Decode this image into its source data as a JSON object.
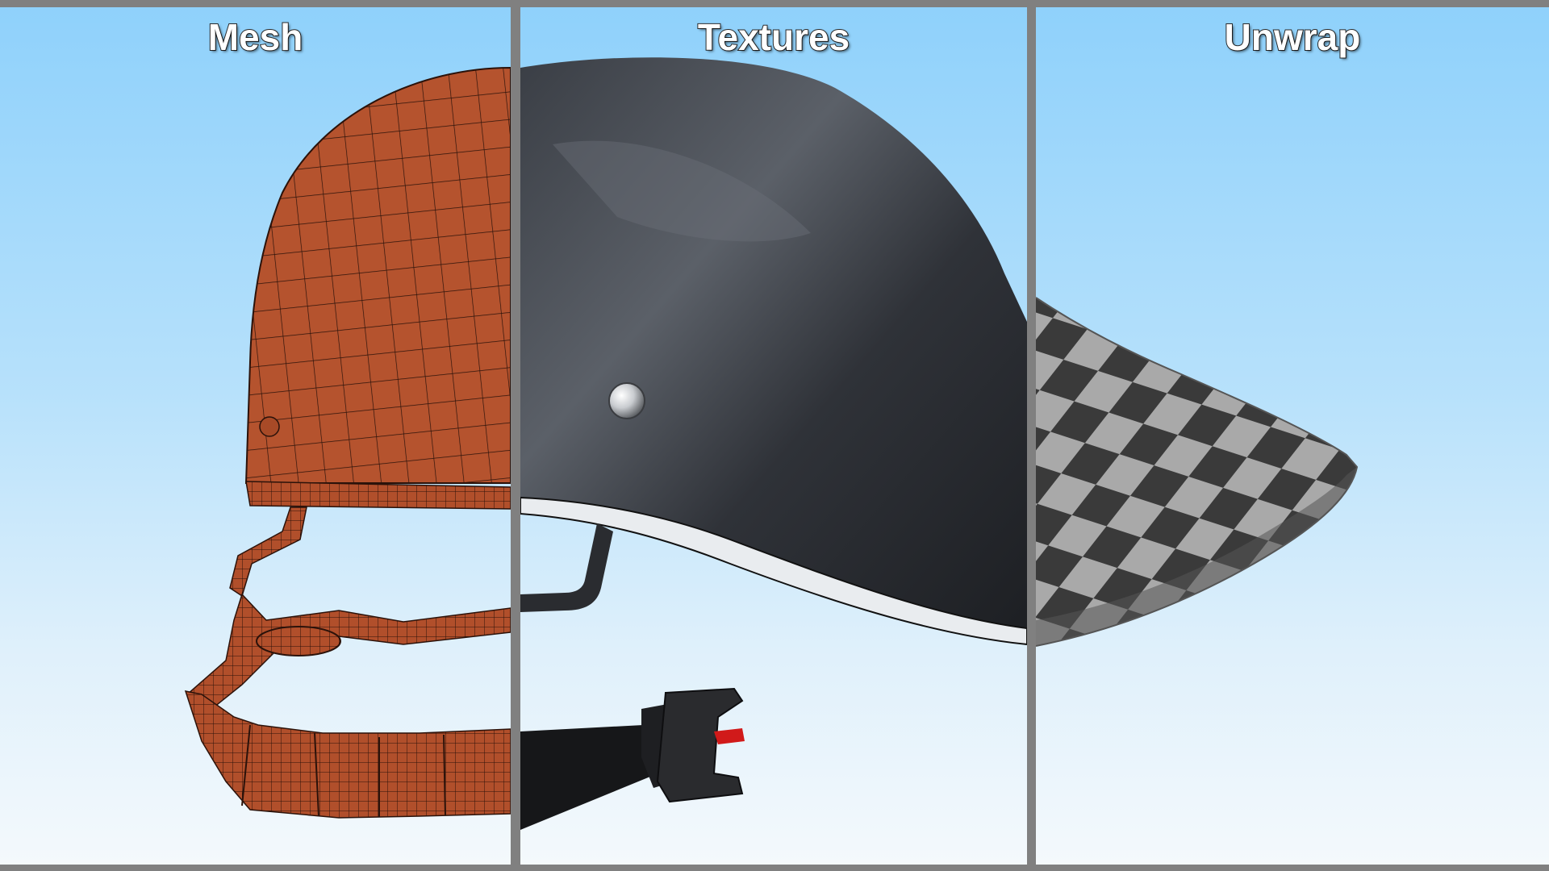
{
  "panels": {
    "mesh": {
      "title": "Mesh"
    },
    "textures": {
      "title": "Textures"
    },
    "unwrap": {
      "title": "Unwrap"
    }
  },
  "colors": {
    "sky_top": "#8fd1fb",
    "sky_bottom": "#f4f9fc",
    "mesh_fill": "#b5532e",
    "helmet_black": "#2e3136",
    "divider": "#808080"
  },
  "icons": [
    "helmet-wireframe",
    "helmet-textured",
    "checker-uv-brim"
  ]
}
